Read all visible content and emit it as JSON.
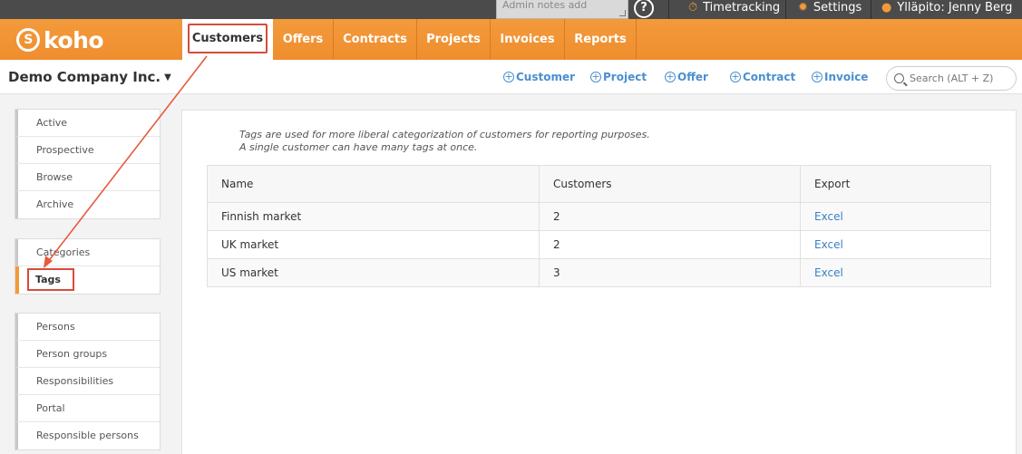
{
  "topbar": {
    "admin_notes_placeholder": "Admin notes add",
    "help": "?",
    "timetracking": "Timetracking",
    "settings": "Settings",
    "user": "Ylläpito: Jenny Berg"
  },
  "navbar": {
    "logo": "koho",
    "tabs": [
      "Customers",
      "Offers",
      "Contracts",
      "Projects",
      "Invoices",
      "Reports"
    ]
  },
  "subheader": {
    "company": "Demo Company Inc.",
    "quick_actions": [
      "Customer",
      "Project",
      "Offer",
      "Contract",
      "Invoice"
    ],
    "search_placeholder": "Search (ALT + Z)"
  },
  "sidebar": {
    "group1": [
      "Active",
      "Prospective",
      "Browse",
      "Archive"
    ],
    "group2": [
      "Categories",
      "Tags"
    ],
    "group3": [
      "Persons",
      "Person groups",
      "Responsibilities",
      "Portal",
      "Responsible persons"
    ]
  },
  "main": {
    "description_line1": "Tags are used for more liberal categorization of customers for reporting purposes.",
    "description_line2": "A single customer can have many tags at once.",
    "table": {
      "headers": [
        "Name",
        "Customers",
        "Export"
      ],
      "rows": [
        {
          "name": "Finnish market",
          "customers": "2",
          "export": "Excel"
        },
        {
          "name": "UK market",
          "customers": "2",
          "export": "Excel"
        },
        {
          "name": "US market",
          "customers": "3",
          "export": "Excel"
        }
      ]
    }
  },
  "colors": {
    "brand_orange": "#f29a3a",
    "annotation_red": "#d64b3c",
    "link_blue": "#3a7fc6"
  }
}
